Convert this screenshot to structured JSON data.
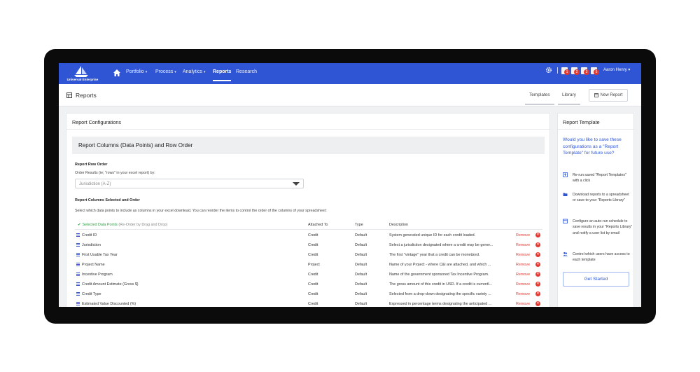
{
  "app": {
    "logo_text": "Universal Enterprise",
    "brand_color": "#2f55d4"
  },
  "nav": {
    "items": [
      {
        "label": "Portfolio",
        "caret": "▾"
      },
      {
        "label": "Process",
        "caret": "▾"
      },
      {
        "label": "Analytics",
        "caret": "▾"
      },
      {
        "label": "Reports",
        "caret": ""
      },
      {
        "label": "Research",
        "caret": ""
      }
    ],
    "active": "Reports",
    "notifications": [
      {
        "count": "1"
      },
      {
        "count": "2"
      },
      {
        "count": "3"
      },
      {
        "count": "5"
      }
    ],
    "user": "Aaron Henry ▾"
  },
  "header": {
    "title": "Reports",
    "tabs": [
      "Templates",
      "Library"
    ],
    "new_report": "New Report"
  },
  "config": {
    "title": "Report Configurations",
    "section_title": "Report Columns (Data Points) and Row Order",
    "row_order_label": "Report Row Order",
    "order_results_label": "Order Results (ie; \"rows\" in your excel report) by:",
    "order_value": "Jurisdiction (A-Z)",
    "columns_label": "Report Columns Selected and Order",
    "columns_help": "Select which data points to include as columns in your excel download. You can reorder the items to control the order of the columns of your spreadsheet:"
  },
  "table": {
    "headers": {
      "selected": "Selected Data Points",
      "selected_sub": "(Re-Order by Drag and Drop)",
      "attached": "Attached To",
      "type": "Type",
      "description": "Description"
    },
    "remove_label": "Remove",
    "rows": [
      {
        "name": "Credit ID",
        "attached": "Credit",
        "type": "Default",
        "description": "System generated unique ID for each credit loaded."
      },
      {
        "name": "Jurisdiction",
        "attached": "Credit",
        "type": "Default",
        "description": "Select a jurisdiction designated where a credit may be gener..."
      },
      {
        "name": "First Usable Tax Year",
        "attached": "Credit",
        "type": "Default",
        "description": "The first \"vintage\" year that a credit can be monetized."
      },
      {
        "name": "Project Name",
        "attached": "Project",
        "type": "Default",
        "description": "Name of your Project - where C&I are attached, and which ..."
      },
      {
        "name": "Incentive Program",
        "attached": "Credit",
        "type": "Default",
        "description": "Name of the government sponsored Tax Incentive Program."
      },
      {
        "name": "Credit Amount Estimate (Gross $)",
        "attached": "Credit",
        "type": "Default",
        "description": "The gross amount of this credit in USD. If a credit is currentl..."
      },
      {
        "name": "Credit Type",
        "attached": "Credit",
        "type": "Default",
        "description": "Selected from a drop-down designating the specific variety ..."
      },
      {
        "name": "Estimated Value Discounted (%)",
        "attached": "Credit",
        "type": "Default",
        "description": "Expressed in percentage terms designating the anticipated ..."
      }
    ]
  },
  "template": {
    "title": "Report Template",
    "question": "Would you like to save these configurations as a \"Report Template\" for future use?",
    "features": [
      {
        "icon": "upload-icon",
        "text": "Re-run saved \"Report Templates\" with a click"
      },
      {
        "icon": "folder-icon",
        "text": "Download reports to a spreadsheet or save to your \"Reports Library\""
      },
      {
        "icon": "calendar-icon",
        "text": "Configure an auto-run schedule to save results in your \"Reports Library\" and notify a user list by email"
      },
      {
        "icon": "users-icon",
        "text": "Control which users have access to each template"
      }
    ],
    "cta": "Get Started"
  }
}
